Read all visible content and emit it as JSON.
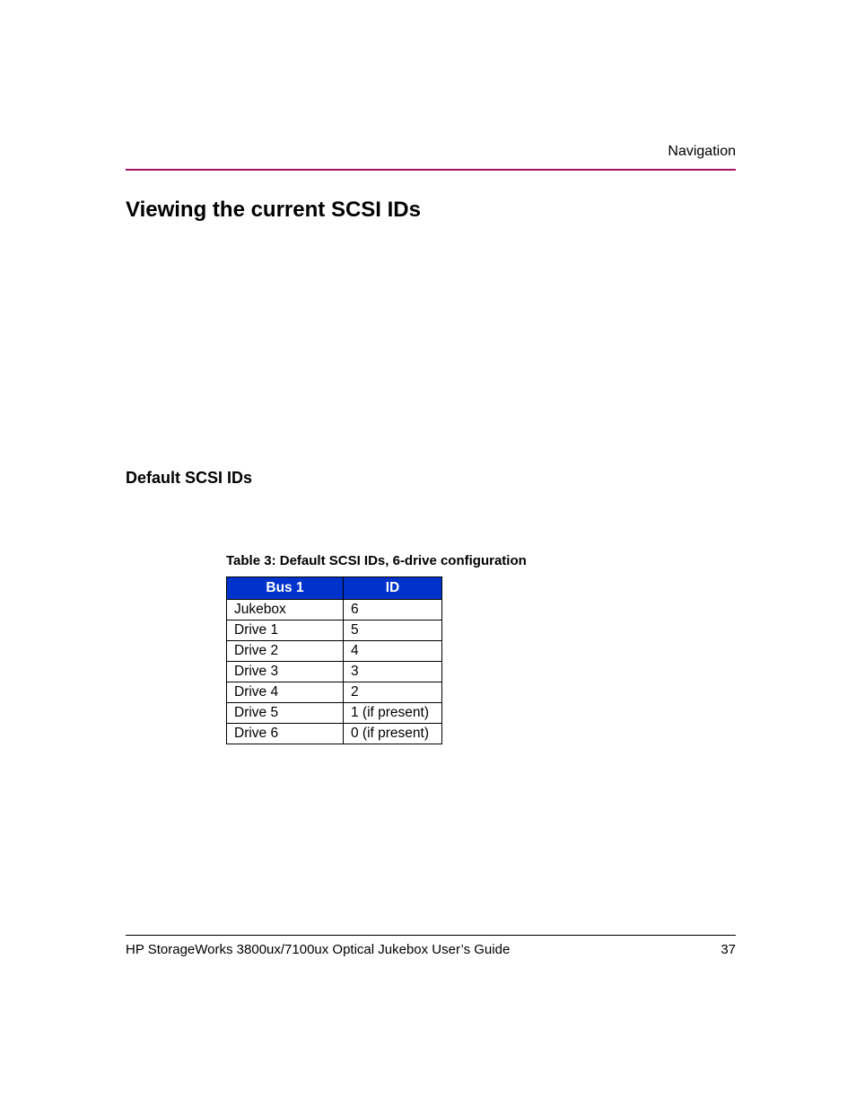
{
  "header": {
    "section": "Navigation"
  },
  "headings": {
    "h1": "Viewing the current SCSI IDs",
    "h2": "Default SCSI IDs"
  },
  "table": {
    "caption": "Table 3:  Default SCSI IDs, 6-drive configuration",
    "col1": "Bus 1",
    "col2": "ID",
    "rows": [
      {
        "bus": "Jukebox",
        "id": "6"
      },
      {
        "bus": "Drive 1",
        "id": "5"
      },
      {
        "bus": "Drive 2",
        "id": "4"
      },
      {
        "bus": "Drive 3",
        "id": "3"
      },
      {
        "bus": "Drive 4",
        "id": "2"
      },
      {
        "bus": "Drive 5",
        "id": "1 (if present)"
      },
      {
        "bus": "Drive 6",
        "id": "0 (if present)"
      }
    ]
  },
  "footer": {
    "title": "HP StorageWorks 3800ux/7100ux Optical Jukebox User’s Guide",
    "page": "37"
  },
  "chart_data": {
    "type": "table",
    "title": "Default SCSI IDs, 6-drive configuration",
    "columns": [
      "Bus 1",
      "ID"
    ],
    "rows": [
      [
        "Jukebox",
        "6"
      ],
      [
        "Drive 1",
        "5"
      ],
      [
        "Drive 2",
        "4"
      ],
      [
        "Drive 3",
        "3"
      ],
      [
        "Drive 4",
        "2"
      ],
      [
        "Drive 5",
        "1 (if present)"
      ],
      [
        "Drive 6",
        "0 (if present)"
      ]
    ]
  }
}
